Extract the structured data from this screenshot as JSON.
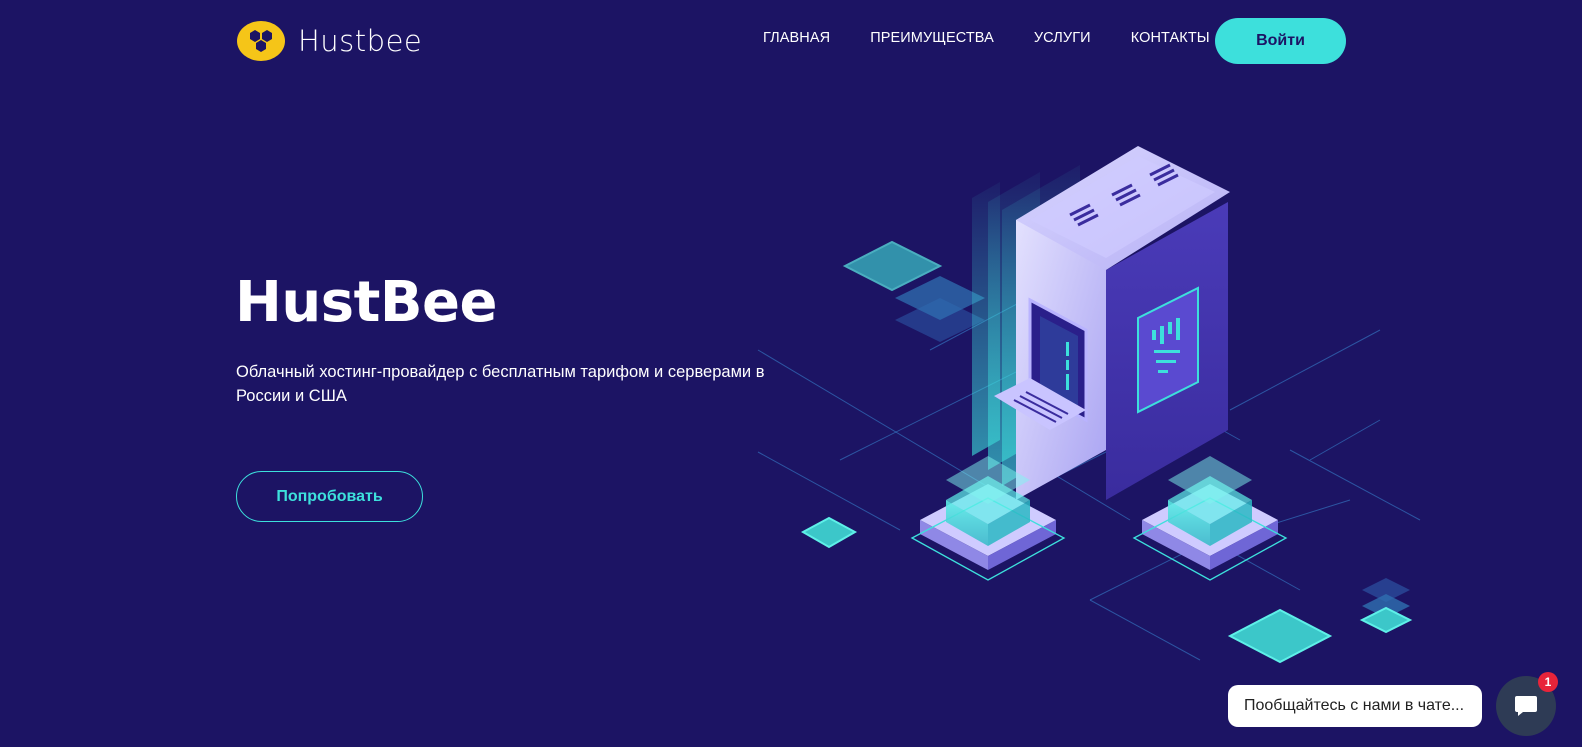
{
  "header": {
    "logo_text": "Hustbee",
    "nav": [
      {
        "label": "ГЛАВНАЯ"
      },
      {
        "label": "ПРЕИМУЩЕСТВА"
      },
      {
        "label": "УСЛУГИ"
      },
      {
        "label": "КОНТАКТЫ"
      }
    ],
    "login_label": "Войти"
  },
  "hero": {
    "title": "HustBee",
    "subtitle": "Облачный хостинг-провайдер с бесплатным тарифом и серверами в России и США",
    "cta_label": "Попробовать",
    "illustration_icon": "server-rack-illustration"
  },
  "chat": {
    "prompt": "Пообщайтесь с нами в чате...",
    "badge_count": "1",
    "icon": "chat-icon"
  },
  "colors": {
    "background": "#1c1464",
    "accent": "#3de0dc",
    "logo_yellow": "#f5c518",
    "badge_red": "#e8243a"
  }
}
